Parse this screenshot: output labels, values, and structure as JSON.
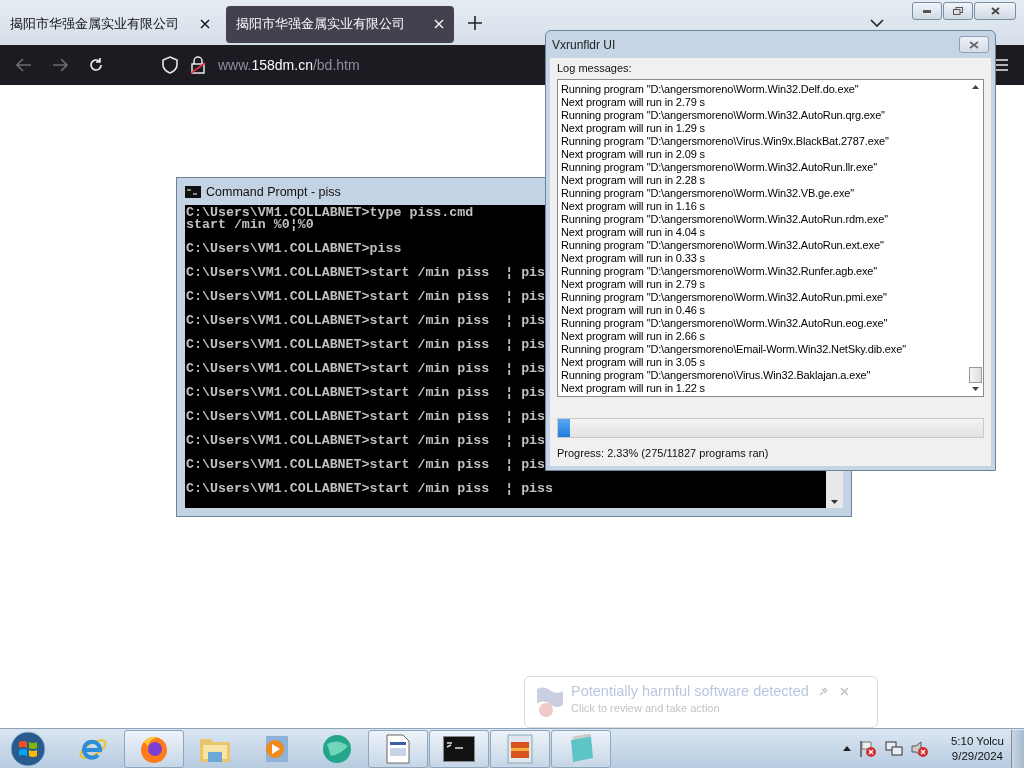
{
  "browser": {
    "tabs": [
      {
        "title": "揭阳市华强金属实业有限公司",
        "selected": false
      },
      {
        "title": "揭阳市华强金属实业有限公司",
        "selected": true
      }
    ],
    "url": {
      "prefix": "www.",
      "domain": "158dm.cn",
      "path": "/bd.htm"
    }
  },
  "cmd_window": {
    "title": "Command Prompt - piss",
    "blocks": [
      [
        "C:\\Users\\VM1.COLLABNET>type piss.cmd",
        "start /min %0¦%0"
      ],
      [
        "C:\\Users\\VM1.COLLABNET>piss"
      ],
      [
        "C:\\Users\\VM1.COLLABNET>start /min piss  ¦ pis"
      ],
      [
        "C:\\Users\\VM1.COLLABNET>start /min piss  ¦ pis"
      ],
      [
        "C:\\Users\\VM1.COLLABNET>start /min piss  ¦ pis"
      ],
      [
        "C:\\Users\\VM1.COLLABNET>start /min piss  ¦ pis"
      ],
      [
        "C:\\Users\\VM1.COLLABNET>start /min piss  ¦ pis"
      ],
      [
        "C:\\Users\\VM1.COLLABNET>start /min piss  ¦ pis"
      ],
      [
        "C:\\Users\\VM1.COLLABNET>start /min piss  ¦ pis"
      ],
      [
        "C:\\Users\\VM1.COLLABNET>start /min piss  ¦ pis"
      ],
      [
        "C:\\Users\\VM1.COLLABNET>start /min piss  ¦ pis"
      ],
      [
        "C:\\Users\\VM1.COLLABNET>start /min piss  ¦ piss"
      ]
    ]
  },
  "runner_window": {
    "title": "Vxrunfldr UI",
    "log_label": "Log messages:",
    "log": [
      "Running program \"D:\\angersmoreno\\Worm.Win32.Delf.do.exe\"",
      "Next program will run in 2.79 s",
      "Running program \"D:\\angersmoreno\\Worm.Win32.AutoRun.qrg.exe\"",
      "Next program will run in 1.29 s",
      "Running program \"D:\\angersmoreno\\Virus.Win9x.BlackBat.2787.exe\"",
      "Next program will run in 2.09 s",
      "Running program \"D:\\angersmoreno\\Worm.Win32.AutoRun.llr.exe\"",
      "Next program will run in 2.28 s",
      "Running program \"D:\\angersmoreno\\Worm.Win32.VB.ge.exe\"",
      "Next program will run in 1.16 s",
      "Running program \"D:\\angersmoreno\\Worm.Win32.AutoRun.rdm.exe\"",
      "Next program will run in 4.04 s",
      "Running program \"D:\\angersmoreno\\Worm.Win32.AutoRun.ext.exe\"",
      "Next program will run in 0.33 s",
      "Running program \"D:\\angersmoreno\\Worm.Win32.Runfer.agb.exe\"",
      "Next program will run in 2.79 s",
      "Running program \"D:\\angersmoreno\\Worm.Win32.AutoRun.pmi.exe\"",
      "Next program will run in 0.46 s",
      "Running program \"D:\\angersmoreno\\Worm.Win32.AutoRun.eog.exe\"",
      "Next program will run in 2.66 s",
      "Running program \"D:\\angersmoreno\\Email-Worm.Win32.NetSky.dib.exe\"",
      "Next program will run in 3.05 s",
      "Running program \"D:\\angersmoreno\\Virus.Win32.Baklajan.a.exe\"",
      "Next program will run in 1.22 s"
    ],
    "progress": {
      "level": 0.0233,
      "text": "Progress: 2.33% (275/11827 programs ran)"
    }
  },
  "notification": {
    "title": "Potentially harmful software detected",
    "text": "Click to review and take action"
  },
  "taskbar": {
    "apps": [
      {
        "kind": "browser-e",
        "running": false
      },
      {
        "kind": "firefox",
        "running": true
      },
      {
        "kind": "folder",
        "running": false
      },
      {
        "kind": "media",
        "running": false
      },
      {
        "kind": "globe",
        "running": false
      },
      {
        "kind": "document",
        "running": true
      },
      {
        "kind": "console",
        "running": true
      },
      {
        "kind": "package",
        "running": true
      },
      {
        "kind": "notepad",
        "running": true
      }
    ],
    "clock": {
      "time": "5:10 Yolcu",
      "date": "9/29/2024"
    }
  }
}
